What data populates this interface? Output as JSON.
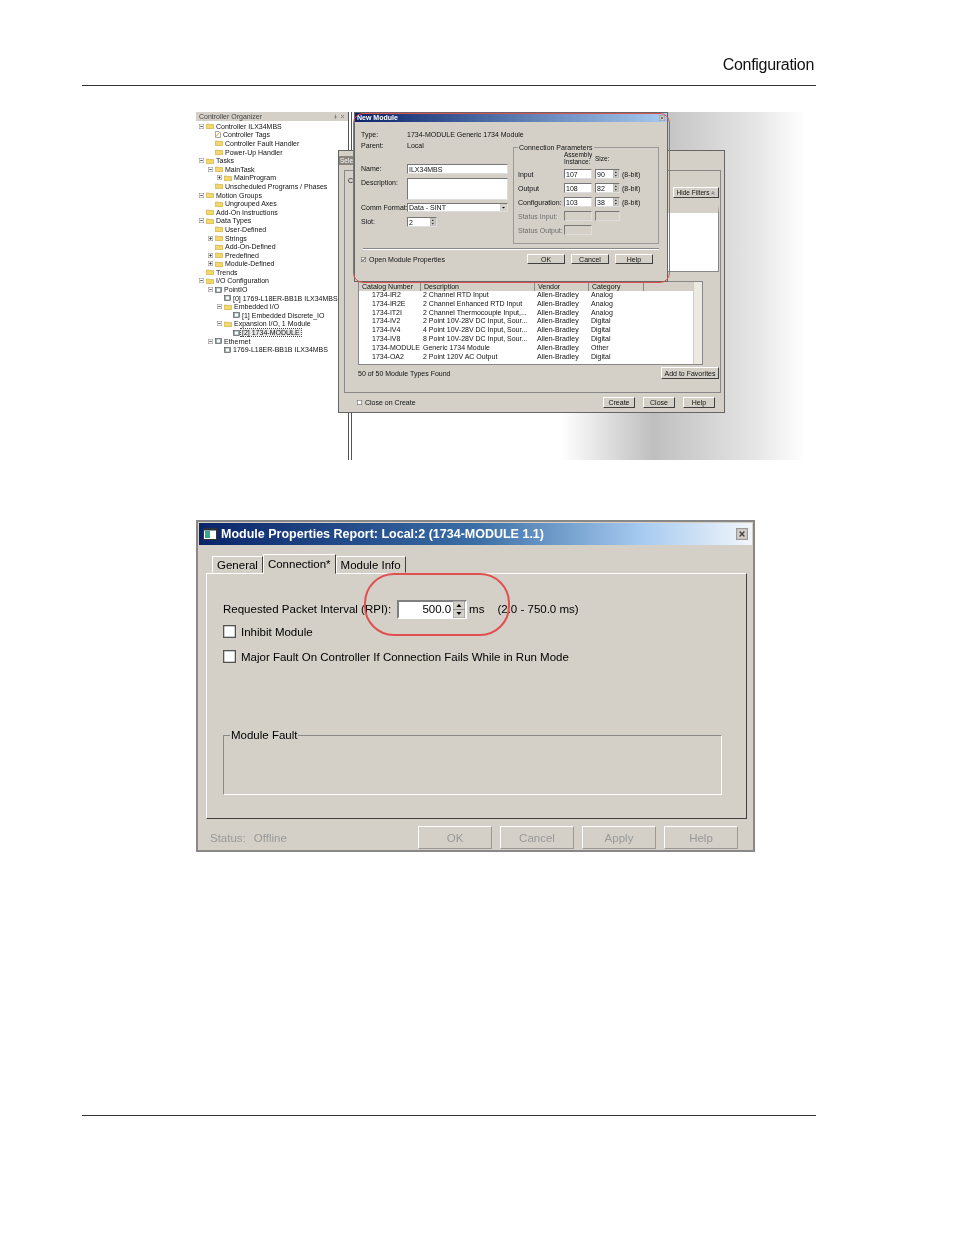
{
  "header": {
    "title": "Configuration"
  },
  "organizer": {
    "title": "Controller Organizer",
    "tree": [
      {
        "label": "Controller ILX34MBS",
        "kind": "folder",
        "expanded": true,
        "selected": false,
        "children": [
          {
            "label": "Controller Tags",
            "kind": "document",
            "selected": false
          },
          {
            "label": "Controller Fault Handler",
            "kind": "folder",
            "selected": false
          },
          {
            "label": "Power-Up Handler",
            "kind": "folder",
            "selected": false
          }
        ]
      },
      {
        "label": "Tasks",
        "kind": "folder",
        "expanded": true,
        "selected": false,
        "children": [
          {
            "label": "MainTask",
            "kind": "folder",
            "expanded": true,
            "selected": false,
            "children": [
              {
                "label": "MainProgram",
                "kind": "folder",
                "expanded": false,
                "selected": false
              }
            ]
          },
          {
            "label": "Unscheduled Programs / Phases",
            "kind": "folder",
            "selected": false
          }
        ]
      },
      {
        "label": "Motion Groups",
        "kind": "folder",
        "expanded": true,
        "selected": false,
        "children": [
          {
            "label": "Ungrouped Axes",
            "kind": "folder",
            "selected": false
          }
        ]
      },
      {
        "label": "Add-On Instructions",
        "kind": "folder",
        "selected": false
      },
      {
        "label": "Data Types",
        "kind": "folder",
        "expanded": true,
        "selected": false,
        "children": [
          {
            "label": "User-Defined",
            "kind": "folder",
            "selected": false
          },
          {
            "label": "Strings",
            "kind": "folder",
            "expanded": false,
            "selected": false
          },
          {
            "label": "Add-On-Defined",
            "kind": "folder",
            "selected": false
          },
          {
            "label": "Predefined",
            "kind": "folder",
            "expanded": false,
            "selected": false
          },
          {
            "label": "Module-Defined",
            "kind": "folder",
            "expanded": false,
            "selected": false
          }
        ]
      },
      {
        "label": "Trends",
        "kind": "folder",
        "selected": false
      },
      {
        "label": "I/O Configuration",
        "kind": "folder",
        "expanded": true,
        "selected": false,
        "children": [
          {
            "label": "PointIO",
            "kind": "module",
            "expanded": true,
            "selected": false,
            "children": [
              {
                "label": "[0] 1769-L18ER-BB1B ILX34MBS",
                "kind": "module",
                "selected": false
              },
              {
                "label": "Embedded I/O",
                "kind": "folder",
                "expanded": true,
                "selected": false,
                "children": [
                  {
                    "label": "[1] Embedded Discrete_IO",
                    "kind": "module",
                    "selected": false
                  }
                ]
              },
              {
                "label": "Expansion I/O, 1 Module",
                "kind": "folder",
                "expanded": true,
                "selected": false,
                "children": [
                  {
                    "label": "[2] 1734-MODULE",
                    "kind": "module",
                    "selected": true
                  }
                ]
              }
            ]
          },
          {
            "label": "Ethernet",
            "kind": "module",
            "expanded": true,
            "selected": false,
            "children": [
              {
                "label": "1769-L18ER-BB1B ILX34MBS",
                "kind": "module",
                "selected": false
              }
            ]
          }
        ]
      }
    ]
  },
  "select_dialog": {
    "tab": "Sele",
    "fragment": "C",
    "hide_filters": "Hide Filters",
    "table": {
      "columns": [
        "Catalog Number",
        "Description",
        "Vendor",
        "Category"
      ],
      "rows": [
        [
          "1734-IR2",
          "2 Channel RTD Input",
          "Allen-Bradley",
          "Analog"
        ],
        [
          "1734-IR2E",
          "2 Channel Enhanced RTD Input",
          "Allen-Bradley",
          "Analog"
        ],
        [
          "1734-IT2I",
          "2 Channel Thermocouple Input,...",
          "Allen-Bradley",
          "Analog"
        ],
        [
          "1734-IV2",
          "2 Point 10V-28V DC Input, Sour...",
          "Allen-Bradley",
          "Digital"
        ],
        [
          "1734-IV4",
          "4 Point 10V-28V DC Input, Sour...",
          "Allen-Bradley",
          "Digital"
        ],
        [
          "1734-IV8",
          "8 Point 10V-28V DC Input, Sour...",
          "Allen-Bradley",
          "Digital"
        ],
        [
          "1734-MODULE",
          "Generic 1734 Module",
          "Allen-Bradley",
          "Other"
        ],
        [
          "1734-OA2",
          "2 Point 120V AC Output",
          "Allen-Bradley",
          "Digital"
        ]
      ]
    },
    "found": "50 of 50 Module Types Found",
    "add_favorites": "Add to Favorites",
    "close_on_create": {
      "label": "Close on Create",
      "checked": false
    },
    "buttons": [
      "Create",
      "Close",
      "Help"
    ]
  },
  "new_module": {
    "title": "New Module",
    "info": [
      {
        "label": "Type:",
        "value": "1734-MODULE Generic 1734 Module"
      },
      {
        "label": "Parent:",
        "value": "Local"
      }
    ],
    "name": {
      "label": "Name:",
      "value": "ILX34MBS"
    },
    "description": {
      "label": "Description:"
    },
    "comm_format": {
      "label": "Comm Format:",
      "value": "Data - SINT"
    },
    "slot": {
      "label": "Slot:",
      "value": "2"
    },
    "connection": {
      "title": "Connection Parameters",
      "instance_header": "Assembly Instance:",
      "size_header": "Size:",
      "rows": [
        {
          "label": "Input",
          "instance": "107",
          "size": "90",
          "unit": "(8-bit)",
          "disabled": false
        },
        {
          "label": "Output",
          "instance": "108",
          "size": "82",
          "unit": "(8-bit)",
          "disabled": false
        },
        {
          "label": "Configuration:",
          "instance": "103",
          "size": "38",
          "unit": "(8-bit)",
          "disabled": false
        },
        {
          "label": "Status Input:",
          "disabled": true
        },
        {
          "label": "Status Output:",
          "disabled": true
        }
      ]
    },
    "open_properties": {
      "label": "Open Module Properties",
      "checked": true
    },
    "buttons": [
      "OK",
      "Cancel",
      "Help"
    ]
  },
  "properties": {
    "title": "Module Properties Report: Local:2 (1734-MODULE 1.1)",
    "tabs": [
      {
        "label": "General",
        "selected": false
      },
      {
        "label": "Connection*",
        "selected": true
      },
      {
        "label": "Module Info",
        "selected": false
      }
    ],
    "rpi": {
      "label": "Requested Packet Interval (RPI):",
      "value": "500.0",
      "unit": "ms",
      "range": "(2.0 - 750.0 ms)"
    },
    "options": [
      {
        "label": "Inhibit Module",
        "checked": false
      },
      {
        "label": "Major Fault On Controller If Connection Fails While in Run Mode",
        "checked": false
      }
    ],
    "fault_group": "Module Fault",
    "status": {
      "label": "Status:",
      "value": "Offline"
    },
    "buttons": [
      "OK",
      "Cancel",
      "Apply",
      "Help"
    ]
  }
}
